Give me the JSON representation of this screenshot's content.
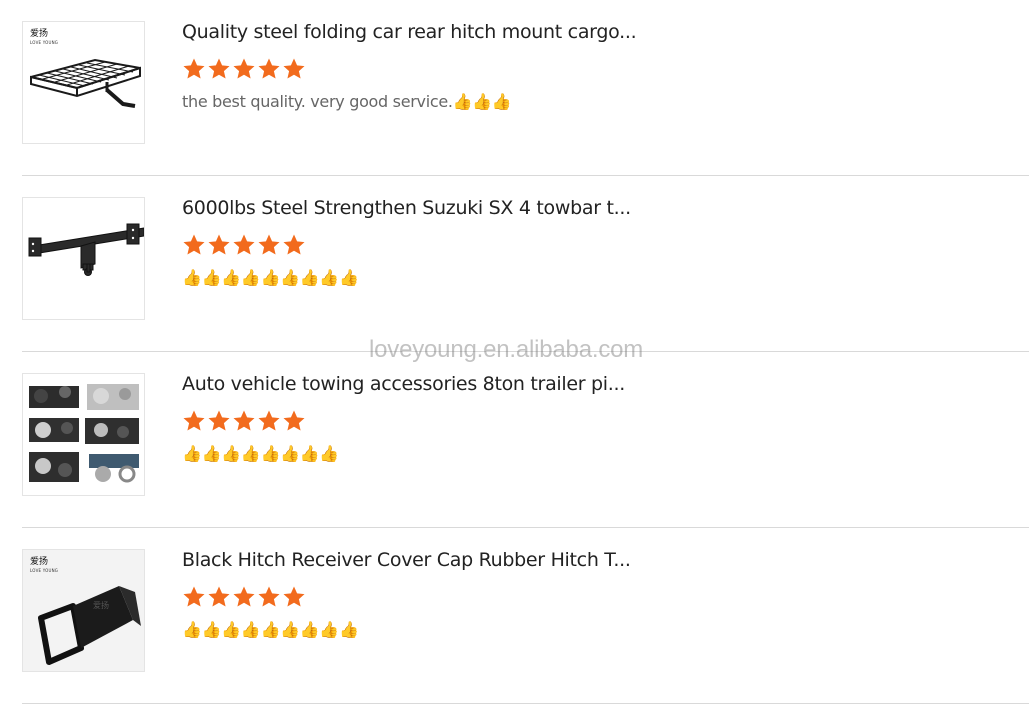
{
  "colors": {
    "star": "#f26b1d",
    "divider": "#d9d9d9",
    "title_text": "#222222",
    "comment_text": "#666666",
    "thumbs_emoji": "#f5b800"
  },
  "watermark": "loveyoung.en.alibaba.com",
  "reviews": [
    {
      "title": "Quality steel folding car rear hitch mount cargo...",
      "rating": 5,
      "comment": "the best quality. very good service.👍👍👍",
      "image": "rear-hitch-cargo-basket",
      "brand_mark": "爱扬",
      "brand_sub": "LOVE YOUNG"
    },
    {
      "title": "6000lbs Steel Strengthen Suzuki SX 4 towbar t...",
      "rating": 5,
      "comment": "👍👍👍👍👍👍👍👍👍",
      "image": "steel-towbar"
    },
    {
      "title": "Auto vehicle towing accessories 8ton trailer pi...",
      "rating": 5,
      "comment": "👍👍👍👍👍👍👍👍",
      "image": "towing-accessories-grid"
    },
    {
      "title": "Black Hitch Receiver Cover Cap Rubber Hitch T...",
      "rating": 5,
      "comment": "👍👍👍👍👍👍👍👍👍",
      "image": "hitch-receiver-cover",
      "brand_mark": "爱扬",
      "brand_sub": "LOVE YOUNG"
    }
  ]
}
